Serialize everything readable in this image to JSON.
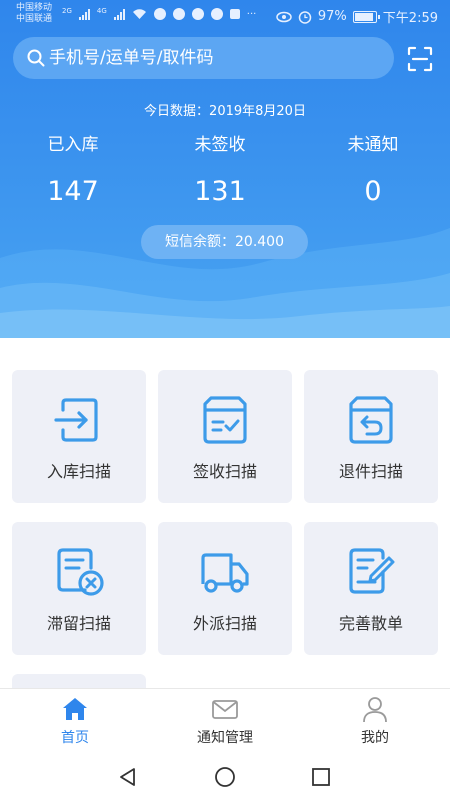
{
  "status_bar": {
    "carrier1": "中国移动",
    "carrier2": "中国联通",
    "net1": "2G",
    "net2": "4G",
    "battery_text": "97%",
    "battery_level": 0.97,
    "time": "下午2:59"
  },
  "search": {
    "placeholder": "手机号/运单号/取件码"
  },
  "today": {
    "label": "今日数据：2019年8月20日"
  },
  "stats": [
    {
      "label": "已入库",
      "value": "147"
    },
    {
      "label": "未签收",
      "value": "131"
    },
    {
      "label": "未通知",
      "value": "0"
    }
  ],
  "balance": {
    "label": "短信余额：20.400"
  },
  "tiles": [
    {
      "label": "入库扫描",
      "icon": "login-arrow-icon"
    },
    {
      "label": "签收扫描",
      "icon": "box-check-icon"
    },
    {
      "label": "退件扫描",
      "icon": "box-return-icon"
    },
    {
      "label": "滞留扫描",
      "icon": "document-cancel-icon"
    },
    {
      "label": "外派扫描",
      "icon": "delivery-truck-icon"
    },
    {
      "label": "完善散单",
      "icon": "document-edit-icon"
    }
  ],
  "tabs": [
    {
      "label": "首页",
      "icon": "home-icon",
      "active": true
    },
    {
      "label": "通知管理",
      "icon": "mail-icon",
      "active": false
    },
    {
      "label": "我的",
      "icon": "user-icon",
      "active": false
    }
  ],
  "colors": {
    "accent": "#2f86ec",
    "tile_bg": "#eef0f7",
    "icon_blue": "#3d9be9"
  }
}
